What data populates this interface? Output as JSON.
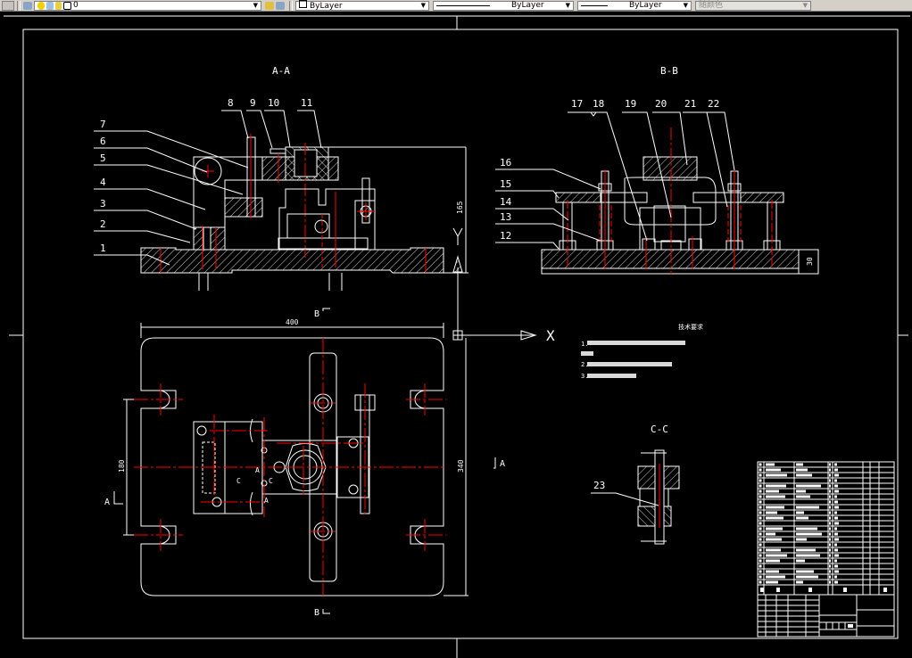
{
  "toolbar": {
    "layer_value": "0",
    "color_value": "ByLayer",
    "linetype_value": "ByLayer",
    "lineweight_value": "ByLayer",
    "plotstyle_value": "随颜色"
  },
  "colors": {
    "background": "#000000",
    "geometry": "#ffffff",
    "centerline": "#ff0000",
    "toolbar": "#d4d0c8"
  },
  "views": {
    "section_aa": "A-A",
    "section_bb": "B-B",
    "section_cc": "C-C"
  },
  "balloons": [
    "1",
    "2",
    "3",
    "4",
    "5",
    "6",
    "7",
    "8",
    "9",
    "10",
    "11",
    "12",
    "13",
    "14",
    "15",
    "16",
    "17",
    "18",
    "19",
    "20",
    "21",
    "22",
    "23"
  ],
  "dimensions": {
    "height_aa": "165",
    "height_bb": "30",
    "width_top": "400",
    "height_top": "340",
    "slot_spacing": "180"
  },
  "section_marks": {
    "b_top": "B",
    "b_bottom": "B",
    "a_left": "A",
    "a_right": "A",
    "c_left": "C",
    "c_right": "C",
    "a_mid1": "A",
    "a_mid2": "A"
  },
  "ucs": {
    "x_label": "X",
    "y_label": "Y"
  },
  "tech_requirements": {
    "title": "技术要求",
    "lines": [
      "1.",
      "",
      "2.",
      "3."
    ]
  }
}
